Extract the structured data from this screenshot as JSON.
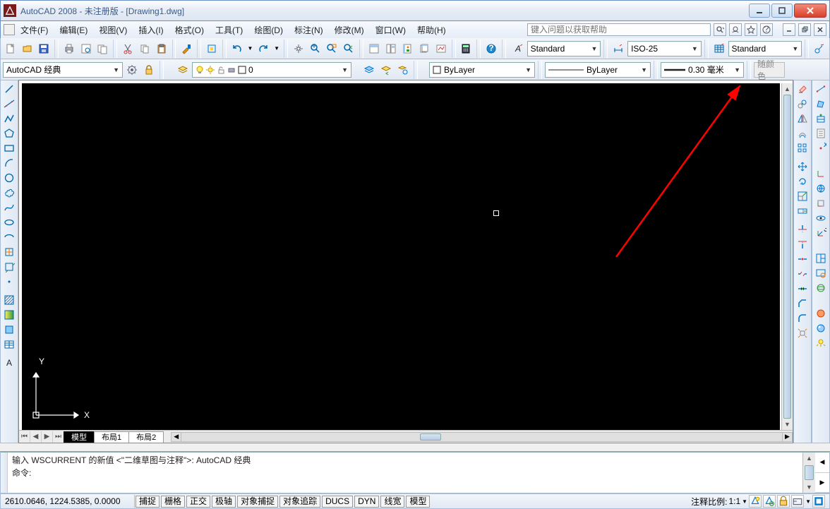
{
  "title": "AutoCAD 2008 - 未注册版 - [Drawing1.dwg]",
  "menu": {
    "file": "文件(F)",
    "edit": "编辑(E)",
    "view": "视图(V)",
    "insert": "插入(I)",
    "format": "格式(O)",
    "tools": "工具(T)",
    "draw": "绘图(D)",
    "dimension": "标注(N)",
    "modify": "修改(M)",
    "window": "窗口(W)",
    "help": "帮助(H)"
  },
  "help_placeholder": "键入问题以获取帮助",
  "workspace": {
    "combo": "AutoCAD 经典",
    "layer_combo": "0",
    "layer_state": "ByLayer",
    "linetype": "ByLayer",
    "lineweight": "0.30 毫米",
    "follow_color": "随颜色"
  },
  "styles": {
    "textstyle": "Standard",
    "dimstyle": "ISO-25",
    "tablestyle": "Standard"
  },
  "tabs": {
    "model": "模型",
    "layout1": "布局1",
    "layout2": "布局2"
  },
  "ucs": {
    "x": "X",
    "y": "Y"
  },
  "command": {
    "line1": "输入 WSCURRENT 的新值 <\"二维草图与注释\">: AutoCAD 经典",
    "line2": "命令:"
  },
  "status": {
    "coords": "2610.0646, 1224.5385, 0.0000",
    "snap": "捕捉",
    "grid": "栅格",
    "ortho": "正交",
    "polar": "极轴",
    "osnap": "对象捕捉",
    "otrack": "对象追踪",
    "ducs": "DUCS",
    "dyn": "DYN",
    "lwt": "线宽",
    "model": "模型",
    "annoscale_label": "注释比例:",
    "annoscale": "1:1"
  }
}
